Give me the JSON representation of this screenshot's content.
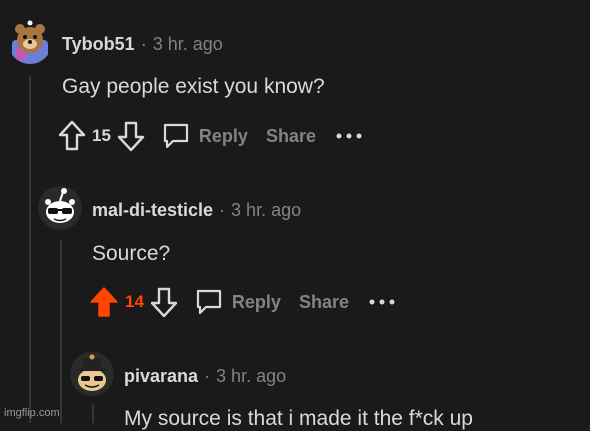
{
  "colors": {
    "background": "#1a1a1b",
    "text": "#d7dadc",
    "muted": "#818384",
    "upvote": "#ff4500",
    "thread_line": "#343536"
  },
  "comments": [
    {
      "username": "Tybob51",
      "separator": "·",
      "age": "3 hr. ago",
      "text": "Gay people exist you know?",
      "score": "15",
      "upvoted": false,
      "reply_label": "Reply",
      "share_label": "Share",
      "avatar": "avatar-bear-icon"
    },
    {
      "username": "mal-di-testicle",
      "separator": "·",
      "age": "3 hr. ago",
      "text": "Source?",
      "score": "14",
      "upvoted": true,
      "reply_label": "Reply",
      "share_label": "Share",
      "avatar": "avatar-snoo-sunglasses-icon"
    },
    {
      "username": "pivarana",
      "separator": "·",
      "age": "3 hr. ago",
      "text": "My source is that i made it the f*ck up",
      "avatar": "avatar-snoo-hat-icon"
    }
  ],
  "watermark": "imgflip.com"
}
